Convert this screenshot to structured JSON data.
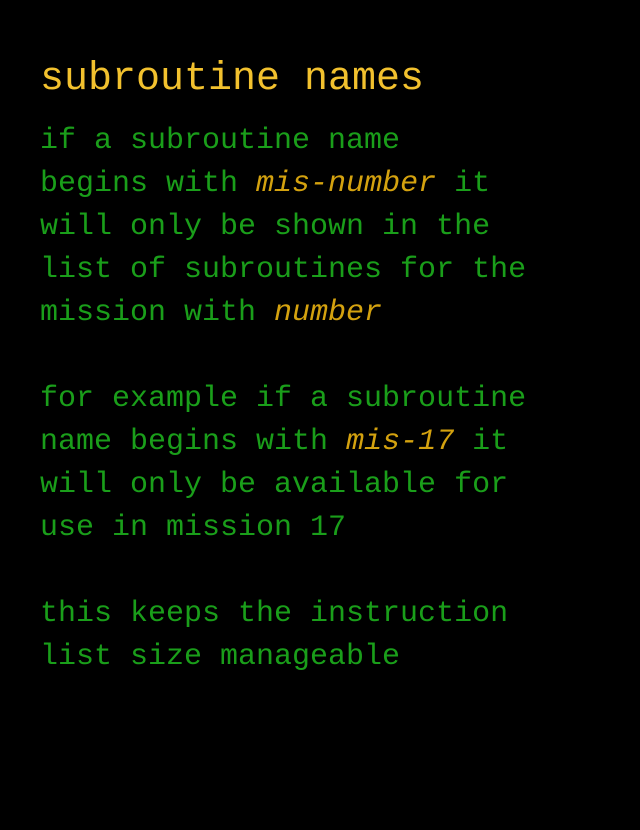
{
  "title": "subroutine names",
  "paragraphs": [
    {
      "lines": [
        {
          "t1": "if a subroutine name"
        },
        {
          "t1": "begins with ",
          "hl": "mis-number",
          "t2": " it"
        },
        {
          "t1": "will only be shown in the"
        },
        {
          "t1": "list of subroutines for the"
        },
        {
          "t1": "mission with ",
          "hl": "number"
        }
      ]
    },
    {
      "lines": [
        {
          "t1": "for example if a subroutine"
        },
        {
          "t1": "name begins with ",
          "hl": "mis-17",
          "t2": " it"
        },
        {
          "t1": "will only be available for"
        },
        {
          "t1": "use in mission 17"
        }
      ]
    },
    {
      "lines": [
        {
          "t1": "this keeps the instruction"
        },
        {
          "t1": "list size manageable"
        }
      ]
    }
  ],
  "colors": {
    "background": "#000000",
    "title": "#f2c12e",
    "body_text": "#1a9e1a",
    "highlight": "#d4a20f"
  }
}
